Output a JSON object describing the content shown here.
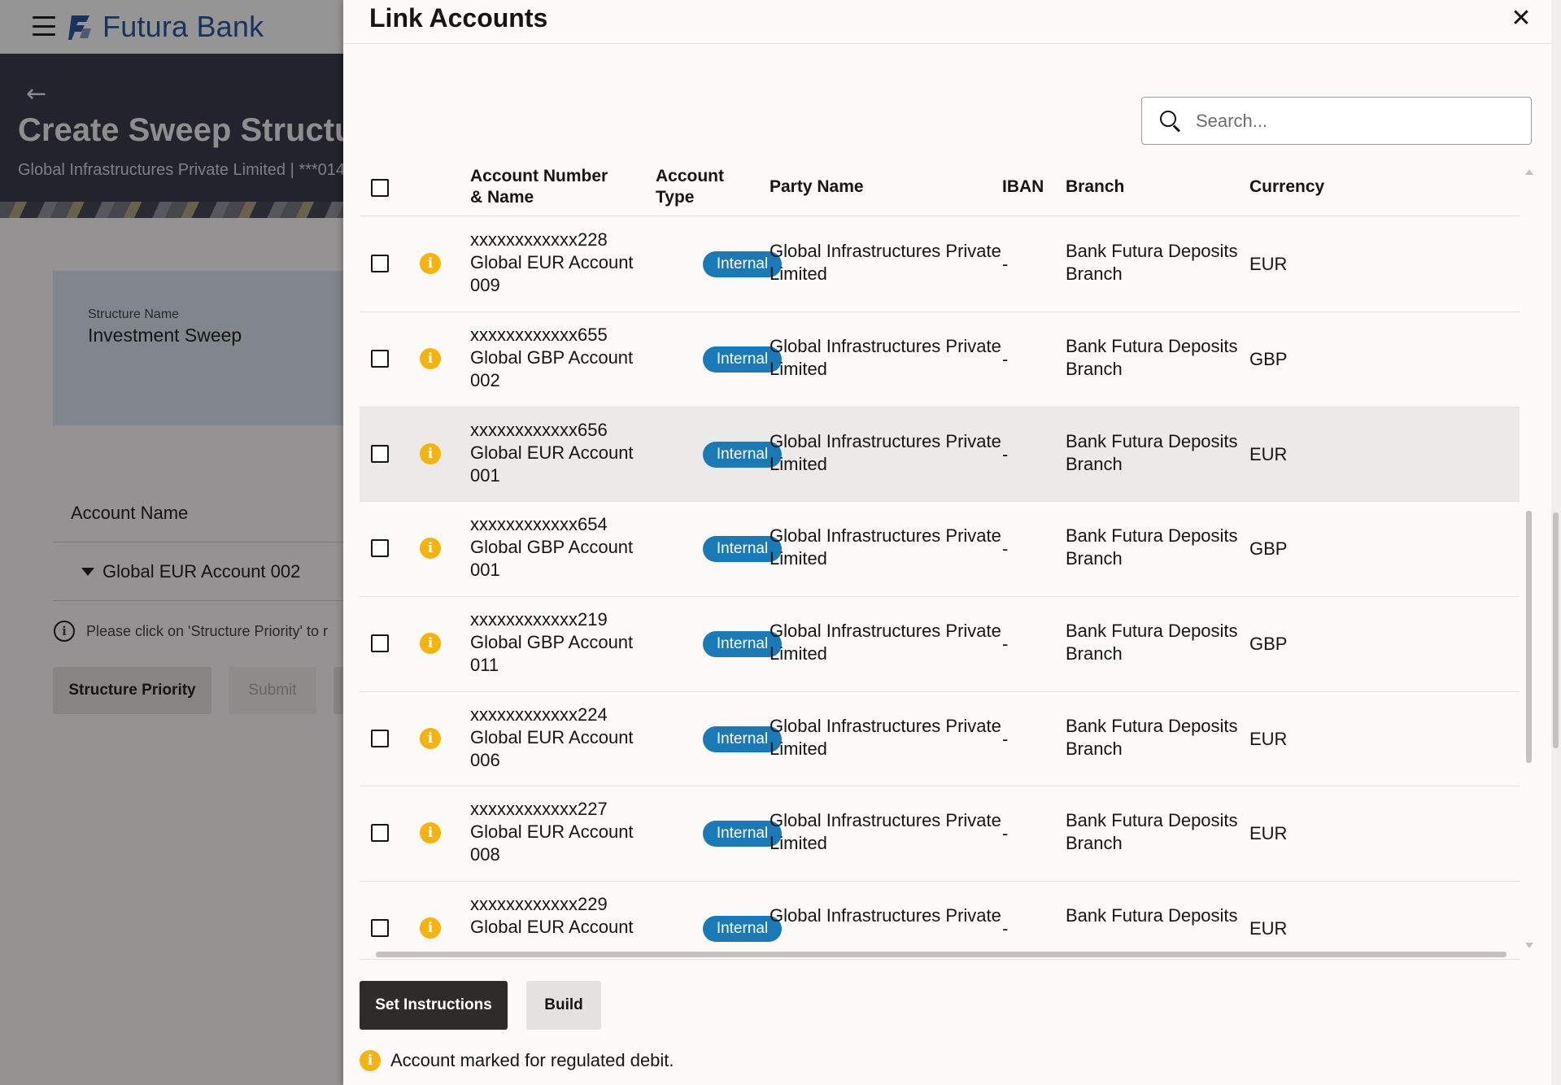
{
  "app": {
    "brand": "Futura Bank",
    "back_label": "←",
    "page_title": "Create Sweep Structure",
    "page_subtitle": "Global Infrastructures Private Limited | ***014"
  },
  "structure": {
    "label": "Structure Name",
    "value": "Investment Sweep"
  },
  "background_table": {
    "header": "Account Name",
    "row": "Global EUR Account 002"
  },
  "background_info": "Please click on 'Structure Priority' to r",
  "background_buttons": {
    "priority": "Structure Priority",
    "submit": "Submit"
  },
  "drawer": {
    "title": "Link Accounts",
    "close": "✕",
    "search_placeholder": "Search...",
    "columns": {
      "account": "Account Number & Name",
      "type": "Account Type",
      "party": "Party Name",
      "iban": "IBAN",
      "branch": "Branch",
      "currency": "Currency"
    },
    "rows": [
      {
        "number": "xxxxxxxxxxxx228",
        "name": "Global EUR Account",
        "suffix": "009",
        "type": "Internal",
        "party": "Global Infrastructures Private",
        "party2": "Limited",
        "iban": "-",
        "branch": "Bank Futura Deposits",
        "branch2": "Branch",
        "currency": "EUR"
      },
      {
        "number": "xxxxxxxxxxxx655",
        "name": "Global GBP Account",
        "suffix": "002",
        "type": "Internal",
        "party": "Global Infrastructures Private",
        "party2": "Limited",
        "iban": "-",
        "branch": "Bank Futura Deposits",
        "branch2": "Branch",
        "currency": "GBP"
      },
      {
        "number": "xxxxxxxxxxxx656",
        "name": "Global EUR Account",
        "suffix": "001",
        "type": "Internal",
        "party": "Global Infrastructures Private",
        "party2": "Limited",
        "iban": "-",
        "branch": "Bank Futura Deposits",
        "branch2": "Branch",
        "currency": "EUR"
      },
      {
        "number": "xxxxxxxxxxxx654",
        "name": "Global GBP Account",
        "suffix": "001",
        "type": "Internal",
        "party": "Global Infrastructures Private",
        "party2": "Limited",
        "iban": "-",
        "branch": "Bank Futura Deposits",
        "branch2": "Branch",
        "currency": "GBP"
      },
      {
        "number": "xxxxxxxxxxxx219",
        "name": "Global GBP Account",
        "suffix": "011",
        "type": "Internal",
        "party": "Global Infrastructures Private",
        "party2": "Limited",
        "iban": "-",
        "branch": "Bank Futura Deposits",
        "branch2": "Branch",
        "currency": "GBP"
      },
      {
        "number": "xxxxxxxxxxxx224",
        "name": "Global EUR Account",
        "suffix": "006",
        "type": "Internal",
        "party": "Global Infrastructures Private",
        "party2": "Limited",
        "iban": "-",
        "branch": "Bank Futura Deposits",
        "branch2": "Branch",
        "currency": "EUR"
      },
      {
        "number": "xxxxxxxxxxxx227",
        "name": "Global EUR Account",
        "suffix": "008",
        "type": "Internal",
        "party": "Global Infrastructures Private",
        "party2": "Limited",
        "iban": "-",
        "branch": "Bank Futura Deposits",
        "branch2": "Branch",
        "currency": "EUR"
      },
      {
        "number": "xxxxxxxxxxxx229",
        "name": "Global EUR Account",
        "suffix": "",
        "type": "Internal",
        "party": "Global Infrastructures Private",
        "party2": "",
        "iban": "-",
        "branch": "Bank Futura Deposits",
        "branch2": "",
        "currency": "EUR"
      }
    ],
    "buttons": {
      "set_instructions": "Set Instructions",
      "build": "Build"
    },
    "legend": "Account marked for regulated debit."
  },
  "icons": {
    "warning": "i",
    "info": "i"
  },
  "colors": {
    "brand": "#1a4f9c",
    "pill": "#1a7ab8",
    "warning": "#f5b30c",
    "primary_button": "#2e2c2a"
  }
}
